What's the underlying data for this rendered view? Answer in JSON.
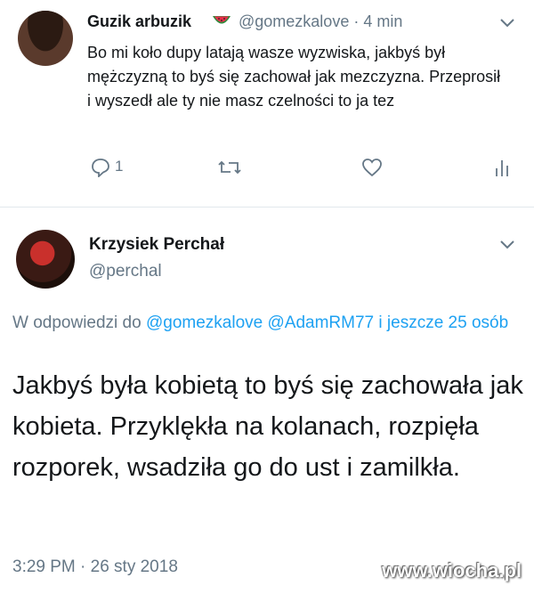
{
  "tweet1": {
    "display_name": "Guzik arbuzik",
    "emoji": "watermelon-icon",
    "handle_time": "@gomezkalove · 4 min",
    "text": "Bo mi koło dupy latają wasze wyzwiska, jakbyś był mężczyzną to byś się zachował jak mezczyzna. Przeprosił i wyszedł ale ty nie masz czelności to ja tez",
    "reply_count": "1"
  },
  "tweet2": {
    "display_name": "Krzysiek Perchał",
    "handle": "@perchal",
    "reply_prefix": "W odpowiedzi do ",
    "reply_mention1": "@gomezkalove",
    "reply_mention2": "@AdamRM77",
    "reply_and": "i",
    "reply_others": "jeszcze 25 osób",
    "text": "Jakbyś była kobietą to byś się zachowała jak kobieta. Przyklękła na kolanach, rozpięła rozporek, wsadziła go do ust i zamilkła.",
    "timestamp": "3:29 PM · 26 sty 2018"
  },
  "watermark": "www.wiocha.pl",
  "colors": {
    "text": "#14171a",
    "secondary": "#657786",
    "link": "#1da1f2",
    "divider": "#e1e8ed"
  }
}
